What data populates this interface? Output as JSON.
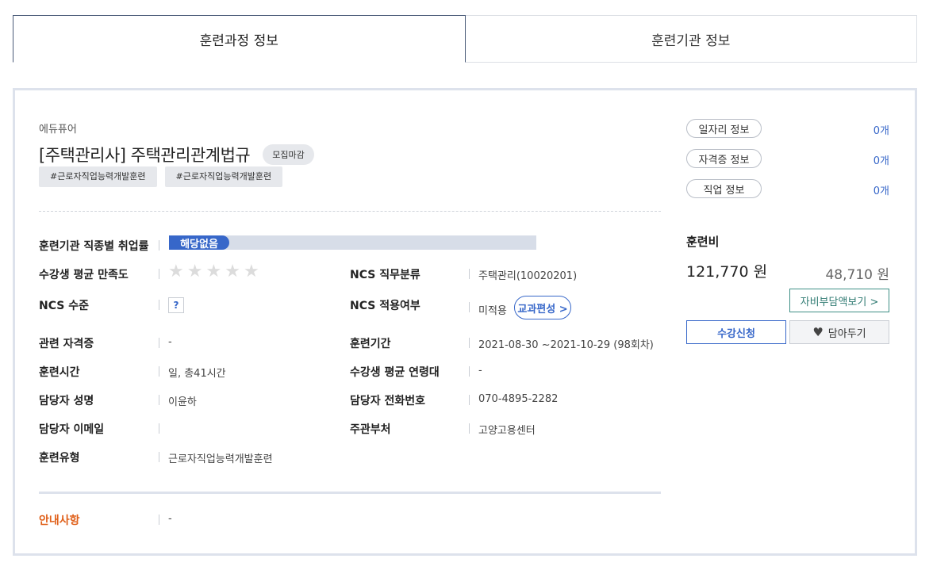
{
  "tabs": [
    {
      "label": "훈련과정 정보",
      "active": true
    },
    {
      "label": "훈련기관 정보",
      "active": false
    }
  ],
  "course": {
    "provider": "에듀퓨어",
    "title": "[주택관리사] 주택관리관계법규",
    "status": "모집마감",
    "hashtags": [
      "#근로자직업능력개발훈련",
      "#근로자직업능력개발훈련"
    ]
  },
  "details": {
    "employment_rate_label": "훈련기관 직종별 취업률",
    "employment_rate_value": "해당없음",
    "satisfaction_label": "수강생 평균 만족도",
    "satisfaction_rating": 0,
    "satisfaction_max": 5,
    "ncs_job_label": "NCS 직무분류",
    "ncs_job_value": "주택관리(10020201)",
    "ncs_level_label": "NCS 수준",
    "ncs_level_help": "?",
    "ncs_apply_label": "NCS 적용여부",
    "ncs_apply_value": "미적용",
    "curriculum_button": "교과편성 >",
    "cert_label": "관련 자격증",
    "cert_value": "-",
    "period_label": "훈련기간",
    "period_value": "2021-08-30 ~2021-10-29 (98회차)",
    "hours_label": "훈련시간",
    "hours_value": "일, 총41시간",
    "age_label": "수강생 평균 연령대",
    "age_value": "-",
    "manager_label": "담당자 성명",
    "manager_value": "이윤하",
    "phone_label": "담당자 전화번호",
    "phone_value": "070-4895-2282",
    "email_label": "담당자 이메일",
    "email_value": "",
    "dept_label": "주관부처",
    "dept_value": "고양고용센터",
    "type_label": "훈련유형",
    "type_value": "근로자직업능력개발훈련",
    "notice_label": "안내사항",
    "notice_value": "-"
  },
  "side": {
    "job_info_label": "일자리 정보",
    "job_info_count": "0개",
    "cert_info_label": "자격증 정보",
    "cert_info_count": "0개",
    "occupation_info_label": "직업 정보",
    "occupation_info_count": "0개",
    "fee_label": "훈련비",
    "fee_price": "121,770 원",
    "fee_self": "48,710 원",
    "self_pay_button": "자비부담액보기 >",
    "apply_button": "수강신청",
    "wish_button": "담아두기"
  },
  "colors": {
    "accent": "#3767c9",
    "notice": "#e0601a",
    "self_pay": "#2f7a72"
  }
}
